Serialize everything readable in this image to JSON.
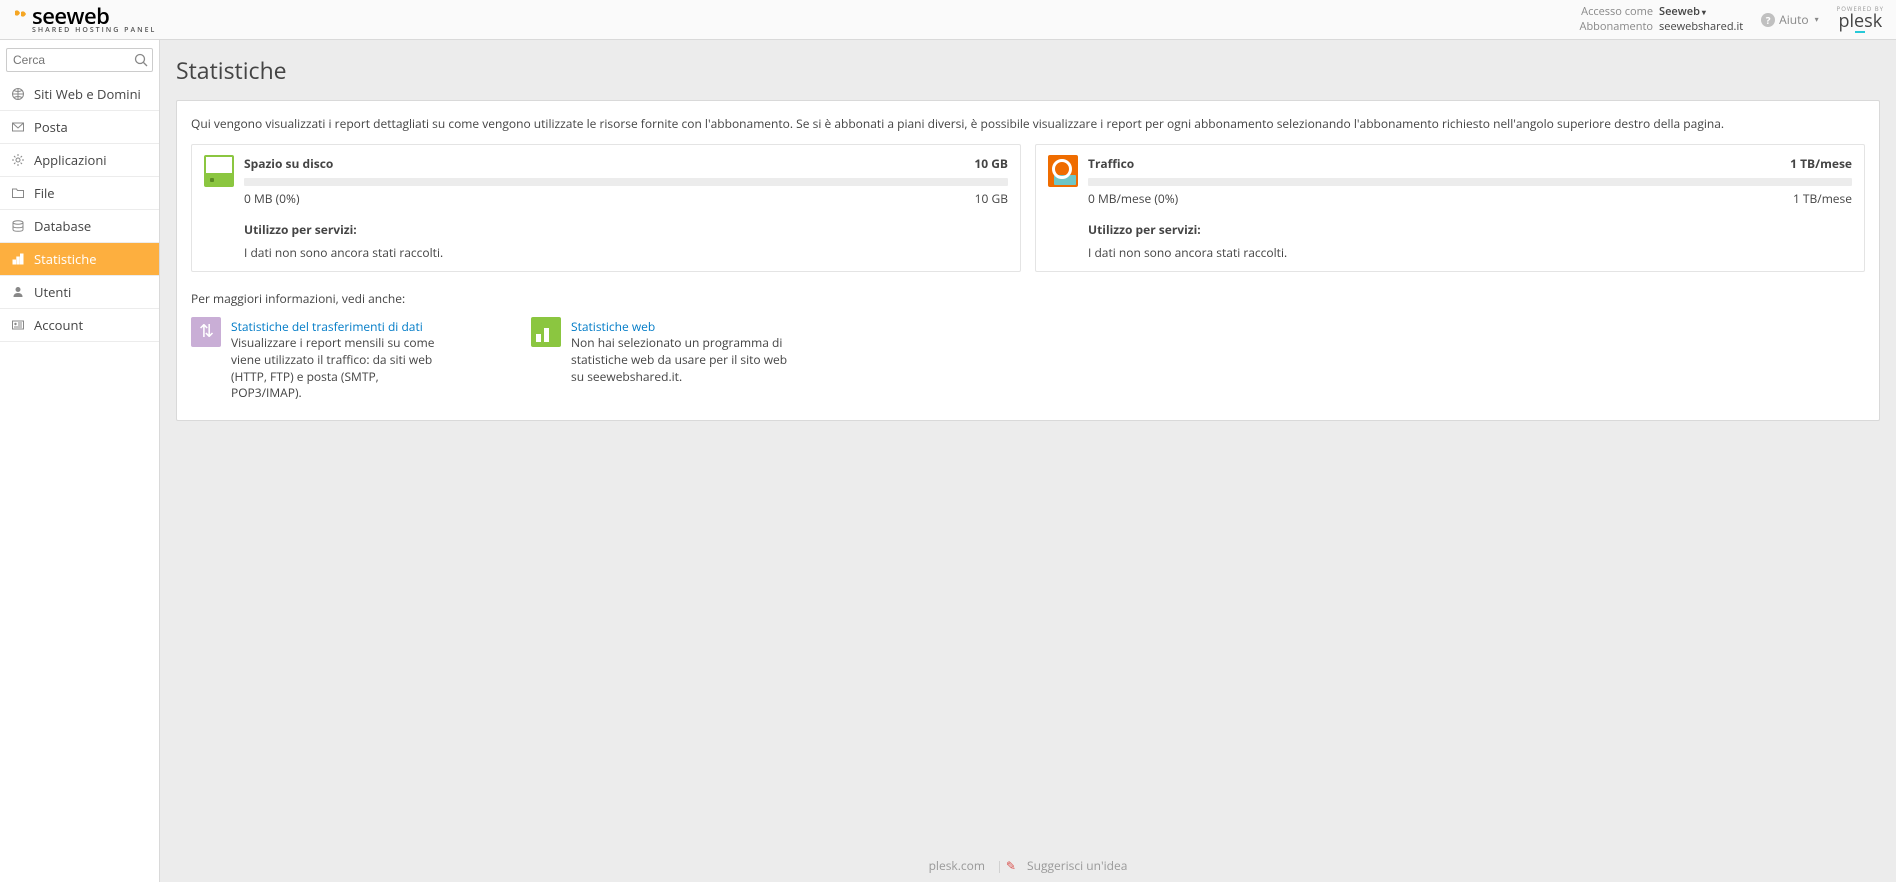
{
  "brand": {
    "main": "seeweb",
    "sub": "SHARED HOSTING PANEL"
  },
  "header": {
    "access_as_label": "Accesso come",
    "user": "Seeweb",
    "subscription_label": "Abbonamento",
    "subscription": "seewebshared.it",
    "help": "Aiuto",
    "powered_by": "POWERED BY",
    "plesk": "plesk"
  },
  "sidebar": {
    "search_placeholder": "Cerca",
    "items": [
      {
        "label": "Siti Web e Domini",
        "icon": "globe"
      },
      {
        "label": "Posta",
        "icon": "mail"
      },
      {
        "label": "Applicazioni",
        "icon": "gear"
      },
      {
        "label": "File",
        "icon": "folder"
      },
      {
        "label": "Database",
        "icon": "database"
      },
      {
        "label": "Statistiche",
        "icon": "stats"
      },
      {
        "label": "Utenti",
        "icon": "user"
      },
      {
        "label": "Account",
        "icon": "card"
      }
    ],
    "active_index": 5
  },
  "page": {
    "title": "Statistiche",
    "intro": "Qui vengono visualizzati i report dettagliati su come vengono utilizzate le risorse fornite con l'abbonamento. Se si è abbonati a piani diversi, è possibile visualizzare i report per ogni abbonamento selezionando l'abbonamento richiesto nell'angolo superiore destro della pagina.",
    "stats": [
      {
        "title": "Spazio su disco",
        "limit": "10 GB",
        "used": "0 MB (0%)",
        "remaining": "10 GB",
        "usage_label": "Utilizzo per servizi:",
        "no_data": "I dati non sono ancora stati raccolti.",
        "icon": "disk"
      },
      {
        "title": "Traffico",
        "limit": "1 TB/mese",
        "used": "0 MB/mese (0%)",
        "remaining": "1 TB/mese",
        "usage_label": "Utilizzo per servizi:",
        "no_data": "I dati non sono ancora stati raccolti.",
        "icon": "traffic"
      }
    ],
    "more_label": "Per maggiori informazioni, vedi anche:",
    "more": [
      {
        "title": "Statistiche del trasferimenti di dati",
        "desc": "Visualizzare i report mensili su come viene utilizzato il traffico: da siti web (HTTP, FTP) e posta (SMTP, POP3/IMAP).",
        "icon": "transfer"
      },
      {
        "title": "Statistiche web",
        "desc": "Non hai selezionato un programma di statistiche web da usare per il sito web su seewebshared.it.",
        "icon": "webstat"
      }
    ]
  },
  "footer": {
    "plesk_link": "plesk.com",
    "suggest": "Suggerisci un'idea"
  }
}
